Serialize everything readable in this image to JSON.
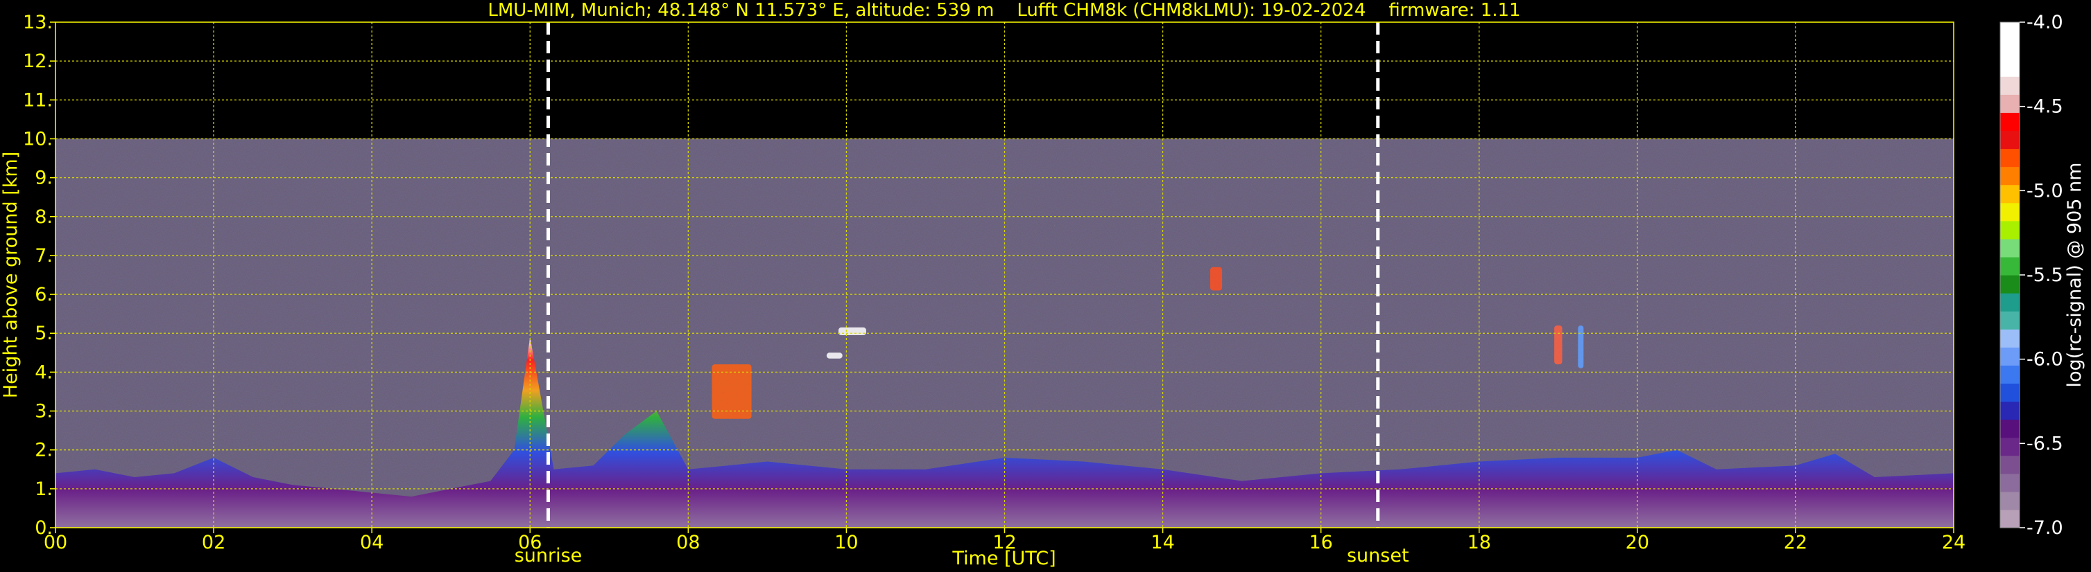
{
  "chart_data": {
    "type": "heatmap",
    "title": "LMU-MIM, Munich; 48.148° N 11.573° E, altitude: 539 m    Lufft CHM8k (CHM8kLMU): 19-02-2024    firmware: 1.11",
    "xlabel": "Time [UTC]",
    "ylabel": "Height above ground [km]",
    "xlim": [
      0,
      24
    ],
    "ylim": [
      0,
      13
    ],
    "xticks": [
      "00",
      "02",
      "04",
      "06",
      "08",
      "10",
      "12",
      "14",
      "16",
      "18",
      "20",
      "22",
      "24"
    ],
    "yticks": [
      "0.",
      "1.",
      "2.",
      "3.",
      "4.",
      "5.",
      "6.",
      "7.",
      "8.",
      "9.",
      "10.",
      "11.",
      "12.",
      "13."
    ],
    "grid": true,
    "data_max_height_km": 10,
    "events": [
      {
        "label": "sunrise",
        "x": 6.23
      },
      {
        "label": "sunset",
        "x": 16.72
      }
    ],
    "boundary_layer_top_km": [
      [
        0,
        1.4
      ],
      [
        0.5,
        1.5
      ],
      [
        1,
        1.3
      ],
      [
        1.5,
        1.4
      ],
      [
        2,
        1.8
      ],
      [
        2.5,
        1.3
      ],
      [
        3,
        1.1
      ],
      [
        3.5,
        1.0
      ],
      [
        4,
        0.9
      ],
      [
        4.5,
        0.8
      ],
      [
        5,
        1.0
      ],
      [
        5.5,
        1.2
      ],
      [
        5.8,
        2.0
      ],
      [
        6,
        4.9
      ],
      [
        6.3,
        1.5
      ],
      [
        6.8,
        1.6
      ],
      [
        7.2,
        2.4
      ],
      [
        7.6,
        3.0
      ],
      [
        8,
        1.5
      ],
      [
        8.5,
        1.6
      ],
      [
        9,
        1.7
      ],
      [
        10,
        1.5
      ],
      [
        11,
        1.5
      ],
      [
        12,
        1.8
      ],
      [
        13,
        1.7
      ],
      [
        14,
        1.5
      ],
      [
        15,
        1.2
      ],
      [
        16,
        1.4
      ],
      [
        17,
        1.5
      ],
      [
        18,
        1.7
      ],
      [
        19,
        1.8
      ],
      [
        20,
        1.8
      ],
      [
        20.5,
        2.0
      ],
      [
        21,
        1.5
      ],
      [
        22,
        1.6
      ],
      [
        22.5,
        1.9
      ],
      [
        23,
        1.3
      ],
      [
        24,
        1.4
      ]
    ],
    "features": [
      {
        "name": "aerosol plume",
        "x0": 8.3,
        "x1": 8.8,
        "y0": 2.8,
        "y1": 4.2,
        "color": "#ff6010"
      },
      {
        "name": "cloud",
        "x0": 9.9,
        "x1": 10.25,
        "y0": 4.95,
        "y1": 5.15,
        "color": "#ffffff"
      },
      {
        "name": "cloud",
        "x0": 9.75,
        "x1": 9.95,
        "y0": 4.35,
        "y1": 4.5,
        "color": "#ffffff"
      },
      {
        "name": "cloud",
        "x0": 14.6,
        "x1": 14.75,
        "y0": 6.1,
        "y1": 6.7,
        "color": "#ff5020"
      },
      {
        "name": "cloud",
        "x0": 18.95,
        "x1": 19.05,
        "y0": 4.2,
        "y1": 5.2,
        "color": "#ff6040"
      },
      {
        "name": "cloud",
        "x0": 19.25,
        "x1": 19.32,
        "y0": 4.1,
        "y1": 5.2,
        "color": "#60a0ff"
      }
    ],
    "colorbar": {
      "label": "log(rc-signal) @ 905 nm",
      "range": [
        -7.0,
        -4.0
      ],
      "ticks": [
        "-4.0",
        "-4.5",
        "-5.0",
        "-5.5",
        "-6.0",
        "-6.5",
        "-7.0"
      ],
      "colors": [
        "#b8a0b8",
        "#a088a8",
        "#8c6c9c",
        "#7c5090",
        "#6a2888",
        "#58107c",
        "#2828b4",
        "#2050dc",
        "#3c78f0",
        "#6c9cf8",
        "#9cbef8",
        "#48b4a8",
        "#1e9c8c",
        "#1a8c1a",
        "#38b838",
        "#78dc78",
        "#a8f000",
        "#f0f000",
        "#ffc000",
        "#ff8000",
        "#ff5000",
        "#e81010",
        "#ff0000",
        "#e8b0b0",
        "#f0d8d8",
        "#ffffff",
        "#ffffff",
        "#ffffff"
      ]
    }
  }
}
